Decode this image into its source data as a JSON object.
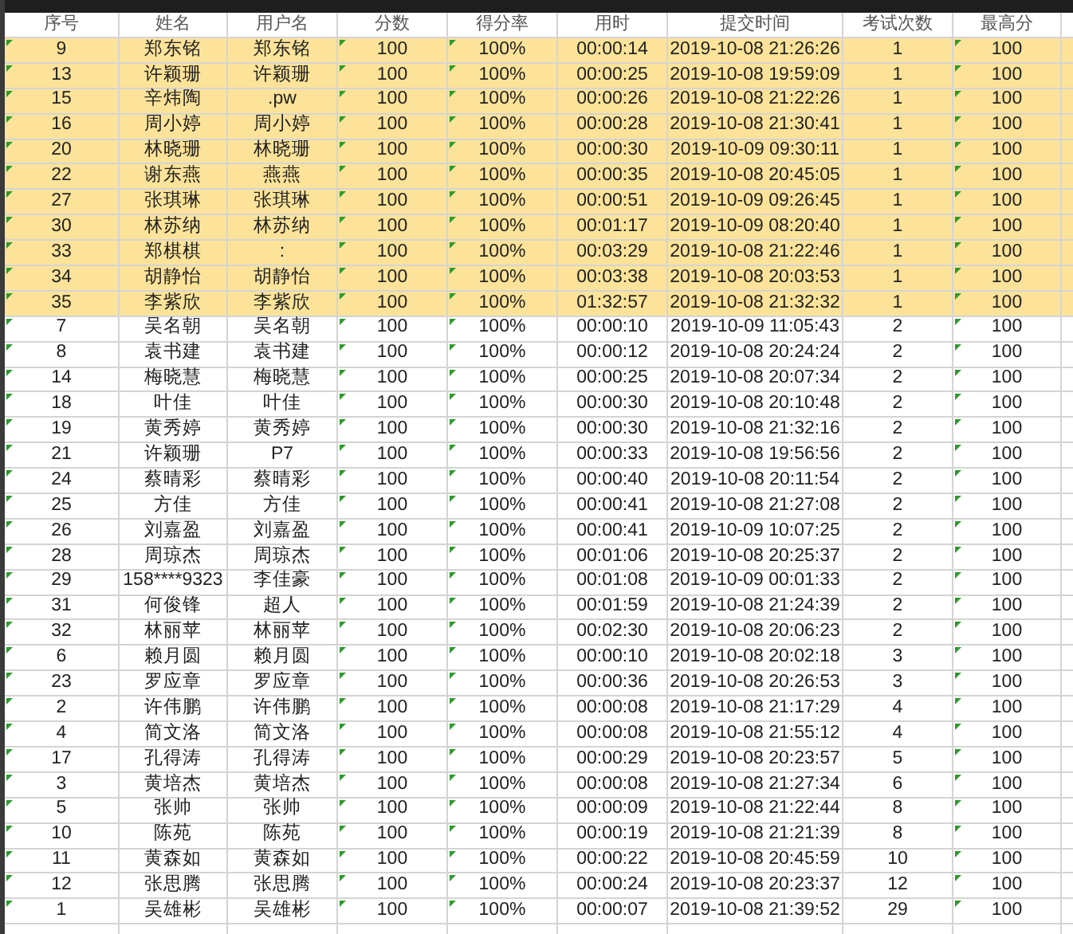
{
  "columns": [
    {
      "label": "序号",
      "flagged": true
    },
    {
      "label": "姓名",
      "flagged": false
    },
    {
      "label": "用户名",
      "flagged": false
    },
    {
      "label": "分数",
      "flagged": true
    },
    {
      "label": "得分率",
      "flagged": true
    },
    {
      "label": "用时",
      "flagged": false
    },
    {
      "label": "提交时间",
      "flagged": false
    },
    {
      "label": "考试次数",
      "flagged": false
    },
    {
      "label": "最高分",
      "flagged": true
    }
  ],
  "rows": [
    {
      "highlighted": true,
      "cells": [
        "9",
        "郑东铭",
        "郑东铭",
        "100",
        "100%",
        "00:00:14",
        "2019-10-08 21:26:26",
        "1",
        "100"
      ]
    },
    {
      "highlighted": true,
      "cells": [
        "13",
        "许颖珊",
        "许颖珊",
        "100",
        "100%",
        "00:00:25",
        "2019-10-08 19:59:09",
        "1",
        "100"
      ]
    },
    {
      "highlighted": true,
      "cells": [
        "15",
        "辛炜陶",
        ".pw",
        "100",
        "100%",
        "00:00:26",
        "2019-10-08 21:22:26",
        "1",
        "100"
      ]
    },
    {
      "highlighted": true,
      "cells": [
        "16",
        "周小婷",
        "周小婷",
        "100",
        "100%",
        "00:00:28",
        "2019-10-08 21:30:41",
        "1",
        "100"
      ]
    },
    {
      "highlighted": true,
      "cells": [
        "20",
        "林晓珊",
        "林晓珊",
        "100",
        "100%",
        "00:00:30",
        "2019-10-09 09:30:11",
        "1",
        "100"
      ]
    },
    {
      "highlighted": true,
      "cells": [
        "22",
        "谢东燕",
        "燕燕",
        "100",
        "100%",
        "00:00:35",
        "2019-10-08 20:45:05",
        "1",
        "100"
      ]
    },
    {
      "highlighted": true,
      "cells": [
        "27",
        "张琪琳",
        "张琪琳",
        "100",
        "100%",
        "00:00:51",
        "2019-10-09 09:26:45",
        "1",
        "100"
      ]
    },
    {
      "highlighted": true,
      "cells": [
        "30",
        "林苏纳",
        "林苏纳",
        "100",
        "100%",
        "00:01:17",
        "2019-10-09 08:20:40",
        "1",
        "100"
      ]
    },
    {
      "highlighted": true,
      "cells": [
        "33",
        "郑棋棋",
        ":",
        "100",
        "100%",
        "00:03:29",
        "2019-10-08 21:22:46",
        "1",
        "100"
      ]
    },
    {
      "highlighted": true,
      "cells": [
        "34",
        "胡静怡",
        "胡静怡",
        "100",
        "100%",
        "00:03:38",
        "2019-10-08 20:03:53",
        "1",
        "100"
      ]
    },
    {
      "highlighted": true,
      "cells": [
        "35",
        "李紫欣",
        "李紫欣",
        "100",
        "100%",
        "01:32:57",
        "2019-10-08 21:32:32",
        "1",
        "100"
      ]
    },
    {
      "highlighted": false,
      "cells": [
        "7",
        "吴名朝",
        "吴名朝",
        "100",
        "100%",
        "00:00:10",
        "2019-10-09 11:05:43",
        "2",
        "100"
      ]
    },
    {
      "highlighted": false,
      "cells": [
        "8",
        "袁书建",
        "袁书建",
        "100",
        "100%",
        "00:00:12",
        "2019-10-08 20:24:24",
        "2",
        "100"
      ]
    },
    {
      "highlighted": false,
      "cells": [
        "14",
        "梅晓慧",
        "梅晓慧",
        "100",
        "100%",
        "00:00:25",
        "2019-10-08 20:07:34",
        "2",
        "100"
      ]
    },
    {
      "highlighted": false,
      "cells": [
        "18",
        "叶佳",
        "叶佳",
        "100",
        "100%",
        "00:00:30",
        "2019-10-08 20:10:48",
        "2",
        "100"
      ]
    },
    {
      "highlighted": false,
      "cells": [
        "19",
        "黄秀婷",
        "黄秀婷",
        "100",
        "100%",
        "00:00:30",
        "2019-10-08 21:32:16",
        "2",
        "100"
      ]
    },
    {
      "highlighted": false,
      "cells": [
        "21",
        "许颖珊",
        "P7",
        "100",
        "100%",
        "00:00:33",
        "2019-10-08 19:56:56",
        "2",
        "100"
      ]
    },
    {
      "highlighted": false,
      "cells": [
        "24",
        "蔡晴彩",
        "蔡晴彩",
        "100",
        "100%",
        "00:00:40",
        "2019-10-08 20:11:54",
        "2",
        "100"
      ]
    },
    {
      "highlighted": false,
      "cells": [
        "25",
        "方佳",
        "方佳",
        "100",
        "100%",
        "00:00:41",
        "2019-10-08 21:27:08",
        "2",
        "100"
      ]
    },
    {
      "highlighted": false,
      "cells": [
        "26",
        "刘嘉盈",
        "刘嘉盈",
        "100",
        "100%",
        "00:00:41",
        "2019-10-09 10:07:25",
        "2",
        "100"
      ]
    },
    {
      "highlighted": false,
      "cells": [
        "28",
        "周琼杰",
        "周琼杰",
        "100",
        "100%",
        "00:01:06",
        "2019-10-08 20:25:37",
        "2",
        "100"
      ]
    },
    {
      "highlighted": false,
      "cells": [
        "29",
        "158****9323",
        "李佳豪",
        "100",
        "100%",
        "00:01:08",
        "2019-10-09 00:01:33",
        "2",
        "100"
      ]
    },
    {
      "highlighted": false,
      "cells": [
        "31",
        "何俊锋",
        "超人",
        "100",
        "100%",
        "00:01:59",
        "2019-10-08 21:24:39",
        "2",
        "100"
      ]
    },
    {
      "highlighted": false,
      "cells": [
        "32",
        "林丽苹",
        "林丽苹",
        "100",
        "100%",
        "00:02:30",
        "2019-10-08 20:06:23",
        "2",
        "100"
      ]
    },
    {
      "highlighted": false,
      "cells": [
        "6",
        "赖月圆",
        "赖月圆",
        "100",
        "100%",
        "00:00:10",
        "2019-10-08 20:02:18",
        "3",
        "100"
      ]
    },
    {
      "highlighted": false,
      "cells": [
        "23",
        "罗应章",
        "罗应章",
        "100",
        "100%",
        "00:00:36",
        "2019-10-08 20:26:53",
        "3",
        "100"
      ]
    },
    {
      "highlighted": false,
      "cells": [
        "2",
        "许伟鹏",
        "许伟鹏",
        "100",
        "100%",
        "00:00:08",
        "2019-10-08 21:17:29",
        "4",
        "100"
      ]
    },
    {
      "highlighted": false,
      "cells": [
        "4",
        "简文洛",
        "简文洛",
        "100",
        "100%",
        "00:00:08",
        "2019-10-08 21:55:12",
        "4",
        "100"
      ]
    },
    {
      "highlighted": false,
      "cells": [
        "17",
        "孔得涛",
        "孔得涛",
        "100",
        "100%",
        "00:00:29",
        "2019-10-08 20:23:57",
        "5",
        "100"
      ]
    },
    {
      "highlighted": false,
      "cells": [
        "3",
        "黄培杰",
        "黄培杰",
        "100",
        "100%",
        "00:00:08",
        "2019-10-08 21:27:34",
        "6",
        "100"
      ]
    },
    {
      "highlighted": false,
      "cells": [
        "5",
        "张帅",
        "张帅",
        "100",
        "100%",
        "00:00:09",
        "2019-10-08 21:22:44",
        "8",
        "100"
      ]
    },
    {
      "highlighted": false,
      "cells": [
        "10",
        "陈苑",
        "陈苑",
        "100",
        "100%",
        "00:00:19",
        "2019-10-08 21:21:39",
        "8",
        "100"
      ]
    },
    {
      "highlighted": false,
      "cells": [
        "11",
        "黄森如",
        "黄森如",
        "100",
        "100%",
        "00:00:22",
        "2019-10-08 20:45:59",
        "10",
        "100"
      ]
    },
    {
      "highlighted": false,
      "cells": [
        "12",
        "张思腾",
        "张思腾",
        "100",
        "100%",
        "00:00:24",
        "2019-10-08 20:23:37",
        "12",
        "100"
      ]
    },
    {
      "highlighted": false,
      "cells": [
        "1",
        "吴雄彬",
        "吴雄彬",
        "100",
        "100%",
        "00:00:07",
        "2019-10-08 21:39:52",
        "29",
        "100"
      ]
    }
  ]
}
